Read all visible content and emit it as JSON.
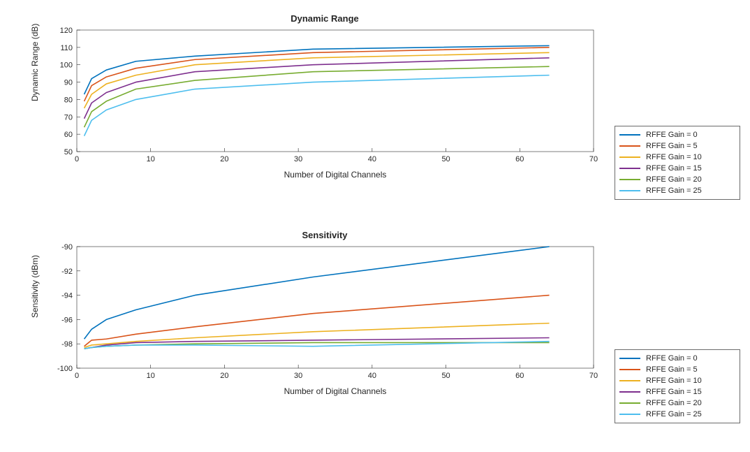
{
  "chart_data": [
    {
      "type": "line",
      "title": "Dynamic Range",
      "xlabel": "Number of Digital Channels",
      "ylabel": "Dynamic Range (dB)",
      "xlim": [
        0,
        70
      ],
      "ylim": [
        50,
        120
      ],
      "xticks": [
        0,
        10,
        20,
        30,
        40,
        50,
        60,
        70
      ],
      "yticks": [
        50,
        60,
        70,
        80,
        90,
        100,
        110,
        120
      ],
      "x": [
        1,
        2,
        4,
        8,
        16,
        32,
        64
      ],
      "series": [
        {
          "name": "RFFE Gain = 0",
          "color": "#0072bd",
          "values": [
            83,
            92,
            97,
            102,
            105,
            109,
            111
          ]
        },
        {
          "name": "RFFE Gain = 5",
          "color": "#d95319",
          "values": [
            79,
            88,
            93,
            98,
            103,
            107,
            110
          ]
        },
        {
          "name": "RFFE Gain = 10",
          "color": "#edb120",
          "values": [
            75,
            83,
            89,
            94,
            100,
            104,
            107
          ]
        },
        {
          "name": "RFFE Gain = 15",
          "color": "#7e2f8e",
          "values": [
            69,
            78,
            84,
            90,
            96,
            100,
            104
          ]
        },
        {
          "name": "RFFE Gain = 20",
          "color": "#77ac30",
          "values": [
            64,
            73,
            79,
            86,
            91,
            96,
            99
          ]
        },
        {
          "name": "RFFE Gain = 25",
          "color": "#4dbeee",
          "values": [
            59,
            68,
            74,
            80,
            86,
            90,
            94
          ]
        }
      ],
      "legend_position": "east-outside"
    },
    {
      "type": "line",
      "title": "Sensitivity",
      "xlabel": "Number of Digital Channels",
      "ylabel": "Sensitivity (dBm)",
      "xlim": [
        0,
        70
      ],
      "ylim": [
        -100,
        -90
      ],
      "xticks": [
        0,
        10,
        20,
        30,
        40,
        50,
        60,
        70
      ],
      "yticks": [
        -100,
        -98,
        -96,
        -94,
        -92,
        -90
      ],
      "x": [
        1,
        2,
        4,
        8,
        16,
        32,
        64
      ],
      "series": [
        {
          "name": "RFFE Gain = 0",
          "color": "#0072bd",
          "values": [
            -97.6,
            -96.8,
            -96.0,
            -95.2,
            -94.0,
            -92.5,
            -90.0
          ]
        },
        {
          "name": "RFFE Gain = 5",
          "color": "#d95319",
          "values": [
            -98.2,
            -97.7,
            -97.6,
            -97.2,
            -96.6,
            -95.5,
            -94.0
          ]
        },
        {
          "name": "RFFE Gain = 10",
          "color": "#edb120",
          "values": [
            -98.3,
            -98.1,
            -98.0,
            -97.8,
            -97.5,
            -97.0,
            -96.3
          ]
        },
        {
          "name": "RFFE Gain = 15",
          "color": "#7e2f8e",
          "values": [
            -98.4,
            -98.3,
            -98.1,
            -97.9,
            -97.8,
            -97.7,
            -97.5
          ]
        },
        {
          "name": "RFFE Gain = 20",
          "color": "#77ac30",
          "values": [
            -98.4,
            -98.3,
            -98.2,
            -98.1,
            -98.0,
            -97.9,
            -97.9
          ]
        },
        {
          "name": "RFFE Gain = 25",
          "color": "#4dbeee",
          "values": [
            -98.4,
            -98.3,
            -98.2,
            -98.1,
            -98.1,
            -98.2,
            -97.8
          ]
        }
      ],
      "legend_position": "east-outside"
    }
  ],
  "legend_labels": {
    "0": "RFFE Gain = 0",
    "1": "RFFE Gain = 5",
    "2": "RFFE Gain = 10",
    "3": "RFFE Gain = 15",
    "4": "RFFE Gain = 20",
    "5": "RFFE Gain = 25"
  },
  "colors": {
    "0": "#0072bd",
    "1": "#d95319",
    "2": "#edb120",
    "3": "#7e2f8e",
    "4": "#77ac30",
    "5": "#4dbeee"
  },
  "titles": {
    "top": "Dynamic Range",
    "bottom": "Sensitivity"
  },
  "xlabels": {
    "top": "Number of Digital Channels",
    "bottom": "Number of Digital Channels"
  },
  "ylabels": {
    "top": "Dynamic Range (dB)",
    "bottom": "Sensitivity (dBm)"
  }
}
